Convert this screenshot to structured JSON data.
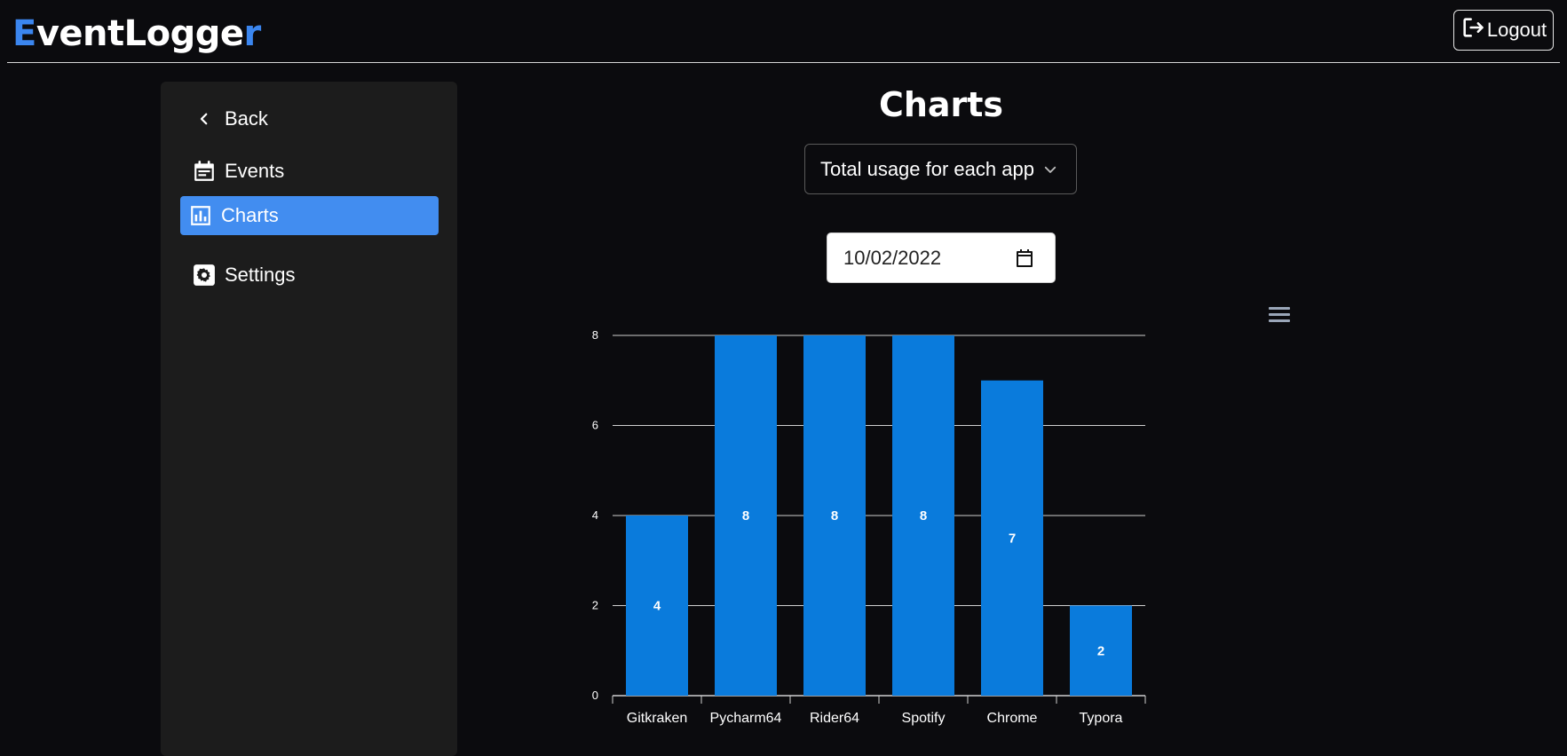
{
  "app": {
    "brand_first": "E",
    "brand_middle": "ventLogge",
    "brand_last": "r",
    "logout_label": "Logout"
  },
  "sidebar": {
    "items": [
      {
        "label": "Back",
        "icon": "chevron-left-icon",
        "active": false
      },
      {
        "label": "Events",
        "icon": "calendar-event-icon",
        "active": false
      },
      {
        "label": "Charts",
        "icon": "bar-chart-icon",
        "active": true
      },
      {
        "label": "Settings",
        "icon": "gear-icon",
        "active": false
      }
    ]
  },
  "main": {
    "title": "Charts",
    "chart_select": {
      "value": "Total usage for each app"
    },
    "date": {
      "value": "10/02/2022"
    }
  },
  "colors": {
    "accent": "#3b86ef",
    "active_nav": "#428df0",
    "bar": "#0a7bdc"
  },
  "chart_data": {
    "type": "bar",
    "categories": [
      "Gitkraken",
      "Pycharm64",
      "Rider64",
      "Spotify",
      "Chrome",
      "Typora"
    ],
    "values": [
      4,
      8,
      8,
      8,
      7,
      2
    ],
    "ylim": [
      0,
      8
    ],
    "yticks": [
      0,
      2,
      4,
      6,
      8
    ],
    "grid": true,
    "data_labels": true,
    "title": "",
    "xlabel": "",
    "ylabel": ""
  }
}
